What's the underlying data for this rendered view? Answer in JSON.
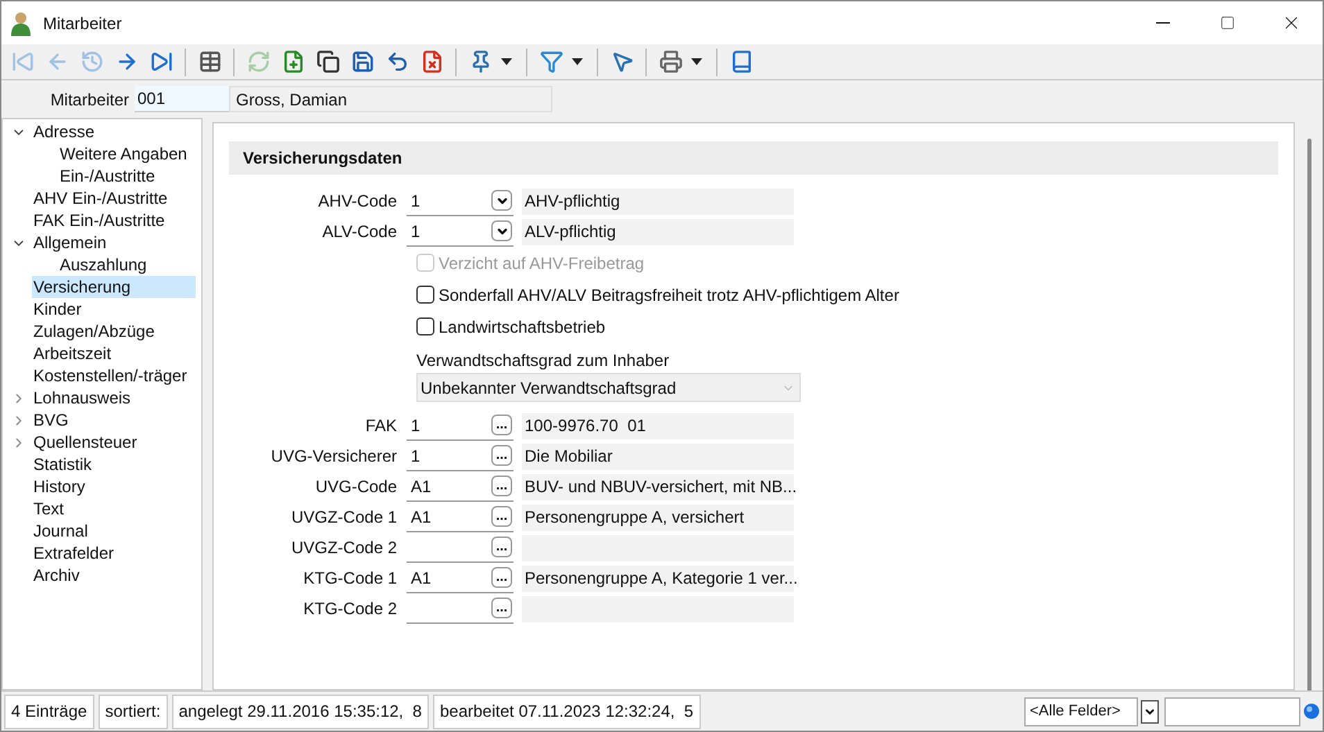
{
  "window": {
    "title": "Mitarbeiter"
  },
  "toolbar": [
    {
      "kind": "first",
      "disabled": true
    },
    {
      "kind": "prev",
      "disabled": true
    },
    {
      "kind": "history",
      "disabled": true
    },
    {
      "kind": "next",
      "disabled": false
    },
    {
      "kind": "last",
      "disabled": false
    },
    {
      "kind": "sep"
    },
    {
      "kind": "table",
      "disabled": false
    },
    {
      "kind": "sep"
    },
    {
      "kind": "refresh",
      "disabled": true
    },
    {
      "kind": "new",
      "disabled": false
    },
    {
      "kind": "copy",
      "disabled": false
    },
    {
      "kind": "save",
      "disabled": false
    },
    {
      "kind": "undo",
      "disabled": false
    },
    {
      "kind": "delete",
      "disabled": false
    },
    {
      "kind": "sep"
    },
    {
      "kind": "pin",
      "disabled": false,
      "menu": true
    },
    {
      "kind": "sep"
    },
    {
      "kind": "filter",
      "disabled": false,
      "menu": true
    },
    {
      "kind": "sep"
    },
    {
      "kind": "pointer",
      "disabled": false
    },
    {
      "kind": "sep"
    },
    {
      "kind": "print",
      "disabled": false,
      "menu": true
    },
    {
      "kind": "sep"
    },
    {
      "kind": "book",
      "disabled": false
    }
  ],
  "header": {
    "label": "Mitarbeiter",
    "number": "001",
    "name": "Gross, Damian"
  },
  "tree": [
    {
      "label": "Adresse",
      "expanded": true,
      "selected": false,
      "children": [
        {
          "label": "Weitere Angaben",
          "selected": false
        },
        {
          "label": "Ein-/Austritte",
          "selected": false
        }
      ]
    },
    {
      "label": "AHV Ein-/Austritte",
      "selected": false
    },
    {
      "label": "FAK Ein-/Austritte",
      "selected": false
    },
    {
      "label": "Allgemein",
      "expanded": true,
      "selected": false,
      "children": [
        {
          "label": "Auszahlung",
          "selected": false
        }
      ]
    },
    {
      "label": "Versicherung",
      "selected": true
    },
    {
      "label": "Kinder",
      "selected": false
    },
    {
      "label": "Zulagen/Abzüge",
      "selected": false
    },
    {
      "label": "Arbeitszeit",
      "selected": false
    },
    {
      "label": "Kostenstellen/-träger",
      "selected": false
    },
    {
      "label": "Lohnausweis",
      "expanded": false,
      "selected": false
    },
    {
      "label": "BVG",
      "expanded": false,
      "selected": false
    },
    {
      "label": "Quellensteuer",
      "expanded": false,
      "selected": false
    },
    {
      "label": "Statistik",
      "selected": false
    },
    {
      "label": "History",
      "selected": false
    },
    {
      "label": "Text",
      "selected": false
    },
    {
      "label": "Journal",
      "selected": false
    },
    {
      "label": "Extrafelder",
      "selected": false
    },
    {
      "label": "Archiv",
      "selected": false
    }
  ],
  "section": {
    "title": "Versicherungsdaten"
  },
  "fields": [
    {
      "kind": "combo",
      "label": "AHV-Code",
      "value": "1",
      "description": "AHV-pflichtig"
    },
    {
      "kind": "combo",
      "label": "ALV-Code",
      "value": "1",
      "description": "ALV-pflichtig"
    },
    {
      "kind": "checkbox",
      "label": "Verzicht auf AHV-Freibetrag",
      "checked": false,
      "disabled": true
    },
    {
      "kind": "checkbox",
      "label": "Sonderfall AHV/ALV Beitragsfreiheit trotz AHV-pflichtigem Alter",
      "checked": false,
      "disabled": false
    },
    {
      "kind": "checkbox",
      "label": "Landwirtschaftsbetrieb",
      "checked": false,
      "disabled": false
    },
    {
      "kind": "select",
      "label": "Verwandtschaftsgrad zum Inhaber",
      "value": "Unbekannter Verwandtschaftsgrad"
    },
    {
      "kind": "lookup",
      "label": "FAK",
      "value": "1",
      "button": "...",
      "description": "100-9976.70  01"
    },
    {
      "kind": "lookup",
      "label": "UVG-Versicherer",
      "value": "1",
      "button": "...",
      "description": "Die Mobiliar"
    },
    {
      "kind": "lookup",
      "label": "UVG-Code",
      "value": "A1",
      "button": "...",
      "description": "BUV- und NBUV-versichert, mit NB..."
    },
    {
      "kind": "lookup",
      "label": "UVGZ-Code 1",
      "value": "A1",
      "button": "...",
      "description": "Personengruppe A, versichert"
    },
    {
      "kind": "lookup",
      "label": "UVGZ-Code 2",
      "button": "..."
    },
    {
      "kind": "lookup",
      "label": "KTG-Code 1",
      "value": "A1",
      "button": "...",
      "description": "Personengruppe A, Kategorie 1 ver..."
    },
    {
      "kind": "lookup",
      "label": "KTG-Code 2",
      "button": "..."
    }
  ],
  "status_bar": {
    "cells": [
      "4 Einträge",
      "sortiert:",
      "angelegt 29.11.2016 15:35:12,  8",
      "bearbeitet 07.11.2023 12:32:24,  5"
    ],
    "filter": "<Alle Felder>"
  }
}
